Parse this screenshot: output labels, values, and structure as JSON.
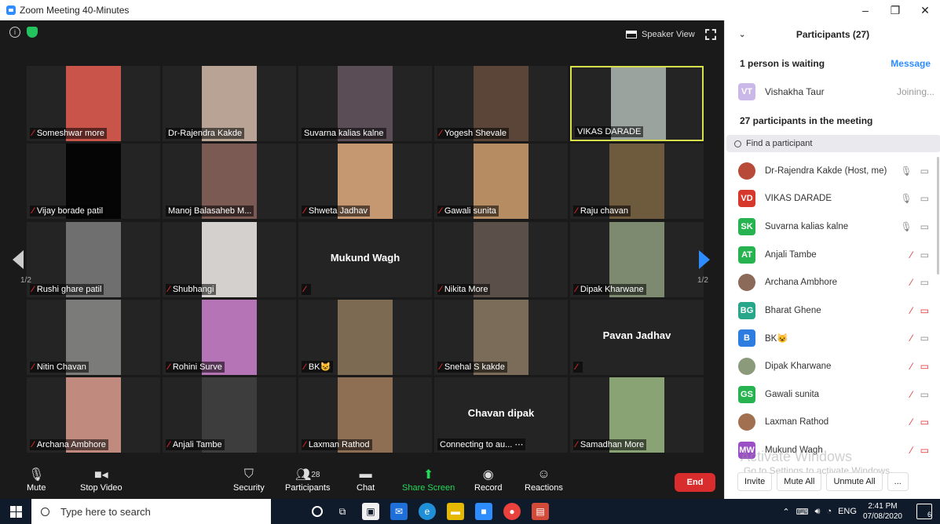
{
  "window": {
    "title": "Zoom Meeting 40-Minutes",
    "controls": [
      "–",
      "❐",
      "✕"
    ]
  },
  "meeting": {
    "speaker_view": "Speaker View",
    "page_left": "1/2",
    "page_right": "1/2"
  },
  "tiles": [
    {
      "name": "Someshwar more",
      "muted": true,
      "video": "#c9544a"
    },
    {
      "name": "Dr-Rajendra Kakde",
      "muted": false,
      "video": "#b9a394"
    },
    {
      "name": "Suvarna kalias kalne",
      "muted": false,
      "video": "#5b4d55"
    },
    {
      "name": "Yogesh Shevale",
      "muted": true,
      "video": "#5a4538"
    },
    {
      "name": "VIKAS DARADE",
      "muted": false,
      "video": "#9aa39e",
      "highlight": true
    },
    {
      "name": "Vijay borade patil",
      "muted": true,
      "video": "#050505"
    },
    {
      "name": "Manoj Balasaheb M...",
      "muted": false,
      "video": "#7a5a52"
    },
    {
      "name": "Shweta Jadhav",
      "muted": true,
      "video": "#c59872"
    },
    {
      "name": "Gawali sunita",
      "muted": true,
      "video": "#b68d63"
    },
    {
      "name": "Raju chavan",
      "muted": true,
      "video": "#6e5a3c"
    },
    {
      "name": "Rushi ghare patil",
      "muted": true,
      "video": "#6f6f70"
    },
    {
      "name": "Shubhangi",
      "muted": true,
      "video": "#d3d0cd"
    },
    {
      "name": "",
      "muted": true,
      "big": "Mukund Wagh"
    },
    {
      "name": "Nikita More",
      "muted": true,
      "video": "#5b4f49"
    },
    {
      "name": "Dipak Kharwane",
      "muted": true,
      "video": "#7d8a6f"
    },
    {
      "name": "Nitin Chavan",
      "muted": true,
      "video": "#7b7b79"
    },
    {
      "name": "Rohini Surve",
      "muted": true,
      "video": "#b574b6"
    },
    {
      "name": "BK😺",
      "muted": true,
      "video": "#7d6a52"
    },
    {
      "name": "Snehal S kakde",
      "muted": true,
      "video": "#7a6c58"
    },
    {
      "name": "",
      "muted": true,
      "big": "Pavan Jadhav"
    },
    {
      "name": "Archana Ambhore",
      "muted": true,
      "video": "#c18a7f"
    },
    {
      "name": "Anjali Tambe",
      "muted": true,
      "video": "#3d3d3d"
    },
    {
      "name": "Laxman Rathod",
      "muted": true,
      "video": "#8e6f54"
    },
    {
      "name": "Connecting to au... ⋯",
      "muted": false,
      "big": "Chavan dipak"
    },
    {
      "name": "Samadhan More",
      "muted": true,
      "video": "#8aa375"
    }
  ],
  "toolbar": {
    "mute": "Mute",
    "stop_video": "Stop Video",
    "security": "Security",
    "participants": "Participants",
    "participants_count": "28",
    "chat": "Chat",
    "share_screen": "Share Screen",
    "record": "Record",
    "reactions": "Reactions",
    "end": "End"
  },
  "panel": {
    "title": "Participants (27)",
    "waiting_title": "1 person is waiting",
    "message": "Message",
    "waiting": {
      "initials": "VT",
      "name": "Vishakha Taur",
      "status": "Joining...",
      "color": "#c9b8e8"
    },
    "count_text": "27 participants in the meeting",
    "search_placeholder": "Find a participant",
    "participants": [
      {
        "initials": "",
        "name": "Dr-Rajendra Kakde (Host, me)",
        "color": "#b84a3a",
        "mic": false,
        "cam": false,
        "photo": true
      },
      {
        "initials": "VD",
        "name": "VIKAS DARADE",
        "color": "#d6392c",
        "mic": false,
        "cam": false
      },
      {
        "initials": "SK",
        "name": "Suvarna kalias kalne",
        "color": "#27b34f",
        "mic": false,
        "cam": false
      },
      {
        "initials": "AT",
        "name": "Anjali Tambe",
        "color": "#27b34f",
        "mic": true,
        "cam": false
      },
      {
        "initials": "",
        "name": "Archana Ambhore",
        "color": "#8c6a5a",
        "mic": true,
        "cam": false,
        "photo": true
      },
      {
        "initials": "BG",
        "name": "Bharat Ghene",
        "color": "#27a68a",
        "mic": true,
        "cam": true
      },
      {
        "initials": "B",
        "name": "BK😺",
        "color": "#2d7de0",
        "mic": true,
        "cam": false
      },
      {
        "initials": "",
        "name": "Dipak Kharwane",
        "color": "#8a9a7a",
        "mic": true,
        "cam": true,
        "photo": true
      },
      {
        "initials": "GS",
        "name": "Gawali sunita",
        "color": "#27b34f",
        "mic": true,
        "cam": false
      },
      {
        "initials": "",
        "name": "Laxman Rathod",
        "color": "#a07050",
        "mic": true,
        "cam": true,
        "photo": true
      },
      {
        "initials": "MW",
        "name": "Mukund Wagh",
        "color": "#9b4fc7",
        "mic": true,
        "cam": true
      }
    ],
    "watermark_1": "Activate Windows",
    "watermark_2": "Go to Settings to activate Windows.",
    "invite": "Invite",
    "mute_all": "Mute All",
    "unmute_all": "Unmute All",
    "more": "..."
  },
  "taskbar": {
    "search": "Type here to search",
    "lang": "ENG",
    "time": "2:41 PM",
    "date": "07/08/2020",
    "notifications": "6"
  }
}
